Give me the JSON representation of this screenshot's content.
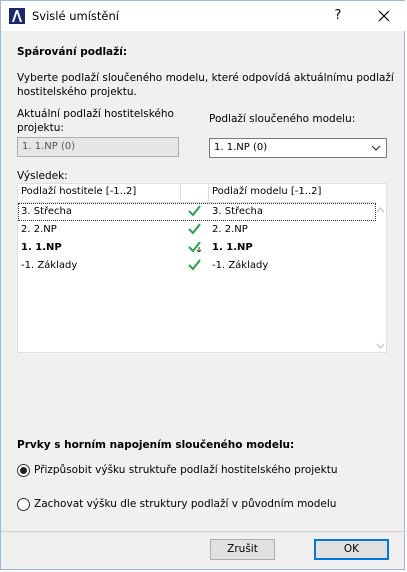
{
  "window": {
    "title": "Svislé umístění",
    "help_label": "?",
    "close_icon": "close-icon",
    "app_icon": "archicad-icon"
  },
  "pairing": {
    "heading": "Spárování podlaží:",
    "description": "Vyberte podlaží sloučeného modelu, které odpovídá aktuálnímu podlaží hostitelského projektu.",
    "host_label": "Aktuální podlaží hostitelského projektu:",
    "host_value": "1. 1.NP (0)",
    "model_label": "Podlaží sloučeného modelu:",
    "model_value": "1. 1.NP (0)"
  },
  "result": {
    "heading": "Výsledek:",
    "columns": [
      "Podlaží hostitele [-1..2]",
      "Podlaží modelu [-1..2]"
    ],
    "rows": [
      {
        "host": "3. Střecha",
        "model": "3. Střecha",
        "bold": false,
        "selected": true,
        "status_icon": "checkmark-icon"
      },
      {
        "host": "2. 2.NP",
        "model": "2. 2.NP",
        "bold": false,
        "selected": false,
        "status_icon": "checkmark-icon"
      },
      {
        "host": "1. 1.NP",
        "model": "1. 1.NP",
        "bold": true,
        "selected": false,
        "status_icon": "checkmark-anchor-icon"
      },
      {
        "host": "-1. Základy",
        "model": "-1. Základy",
        "bold": false,
        "selected": false,
        "status_icon": "checkmark-icon"
      }
    ]
  },
  "top_link": {
    "heading": "Prvky s horním napojením sloučeného modelu:",
    "options": [
      {
        "label": "Přizpůsobit výšku struktuře podlaží hostitelského projektu",
        "checked": true
      },
      {
        "label": "Zachovat výšku dle struktury podlaží v původním modelu",
        "checked": false
      }
    ]
  },
  "buttons": {
    "cancel": "Zrušit",
    "ok": "OK"
  },
  "colors": {
    "check": "#2aa24a",
    "accent": "#0078d7"
  }
}
